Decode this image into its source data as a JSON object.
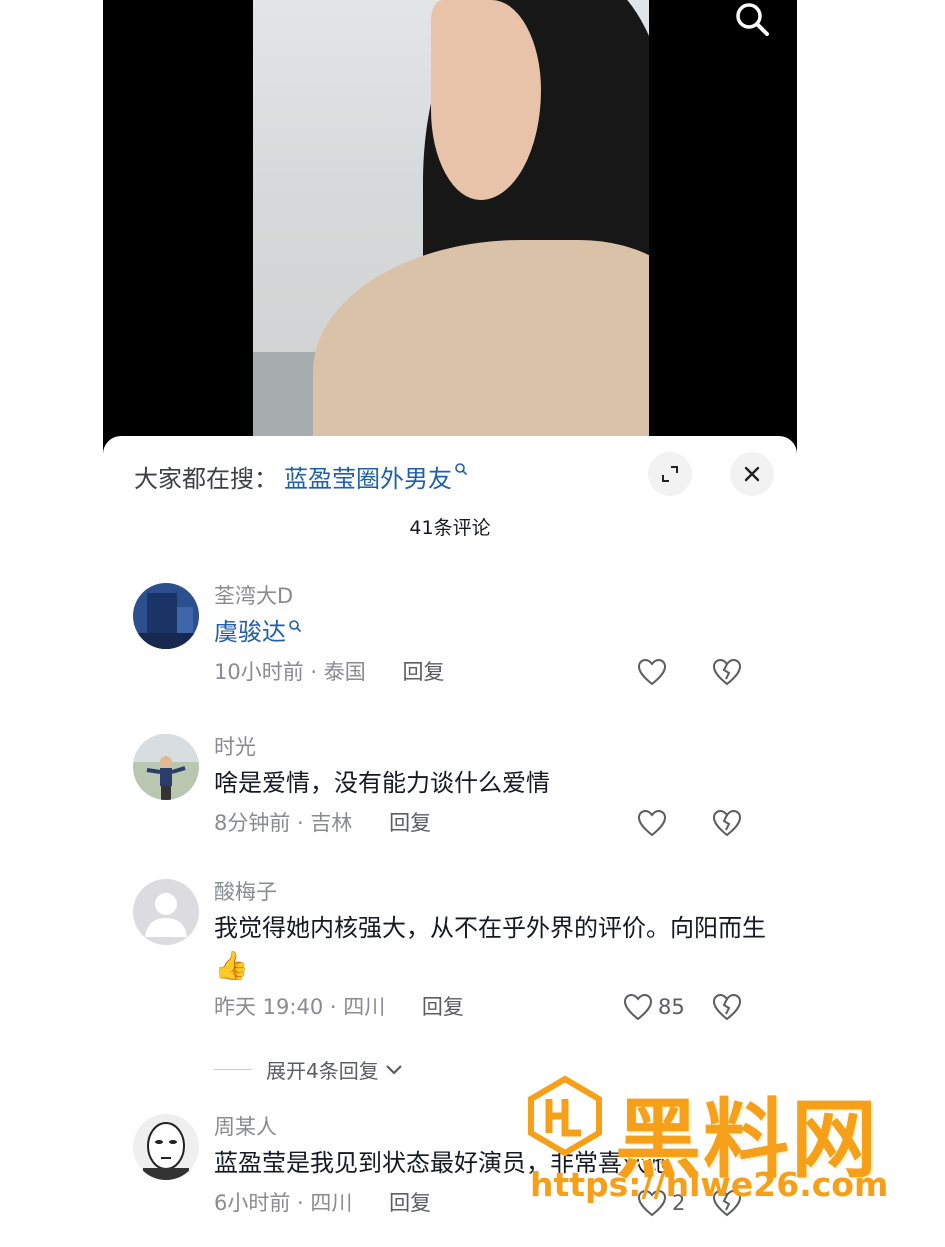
{
  "video": {
    "search_icon": "search-icon"
  },
  "panel": {
    "hot_search_prefix": "大家都在搜：",
    "hot_search_term": "蓝盈莹圈外男友",
    "comment_count_label": "41条评论"
  },
  "comments": [
    {
      "username": "荃湾大D",
      "text": "虞骏达",
      "text_is_search_link": true,
      "time": "10小时前",
      "location": "泰国",
      "reply_label": "回复",
      "likes": ""
    },
    {
      "username": "时光",
      "text": "啥是爱情，没有能力谈什么爱情",
      "time": "8分钟前",
      "location": "吉林",
      "reply_label": "回复",
      "likes": ""
    },
    {
      "username": "酸梅子",
      "text": "我觉得她内核强大，从不在乎外界的评价。向阳而生",
      "emoji": "👍",
      "time": "昨天 19:40",
      "location": "四川",
      "reply_label": "回复",
      "likes": "85"
    },
    {
      "username": "周某人",
      "text": "蓝盈莹是我见到状态最好演员，非常喜欢她",
      "time": "6小时前",
      "location": "四川",
      "reply_label": "回复",
      "likes": "2"
    }
  ],
  "expand_replies_label": "展开4条回复",
  "meta_separator": " · ",
  "watermark": {
    "title": "黑料网",
    "url": "https://hlwe26.com"
  },
  "colors": {
    "link_blue": "#1f5ea8",
    "meta_gray": "#8a8b91",
    "watermark_orange": "#f6a01a"
  }
}
